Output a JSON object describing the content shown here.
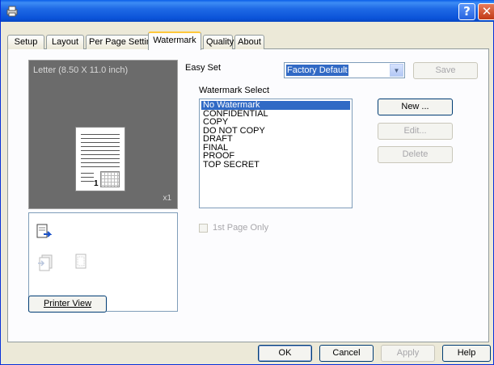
{
  "window": {
    "help_glyph": "?",
    "close_glyph": "✕"
  },
  "tabs": [
    {
      "label": "Setup",
      "active": false
    },
    {
      "label": "Layout",
      "active": false
    },
    {
      "label": "Per Page Setting",
      "active": false
    },
    {
      "label": "Watermark",
      "active": true
    },
    {
      "label": "Quality",
      "active": false
    },
    {
      "label": "About",
      "active": false
    }
  ],
  "preview": {
    "paper_label": "Letter  (8.50 X 11.0 inch)",
    "page_number": "1",
    "copies": "x1",
    "printer_view_button": "Printer View"
  },
  "easy_set": {
    "label": "Easy Set",
    "value": "Factory Default",
    "save_button": "Save"
  },
  "watermark_select": {
    "label": "Watermark Select",
    "items": [
      "No Watermark",
      "CONFIDENTIAL",
      "COPY",
      "DO NOT COPY",
      "DRAFT",
      "FINAL",
      "PROOF",
      "TOP SECRET"
    ],
    "selected_index": 0,
    "new_button": "New ...",
    "edit_button": "Edit...",
    "delete_button": "Delete"
  },
  "first_page_only": {
    "label": "1st Page Only",
    "checked": false,
    "enabled": false
  },
  "footer": {
    "ok": "OK",
    "cancel": "Cancel",
    "apply": "Apply",
    "help": "Help"
  },
  "colors": {
    "titlebar": "#0a52d8",
    "selection": "#316ac5",
    "preview_bg": "#6b6b6b",
    "active_tab_highlight": "#ffc83c"
  }
}
